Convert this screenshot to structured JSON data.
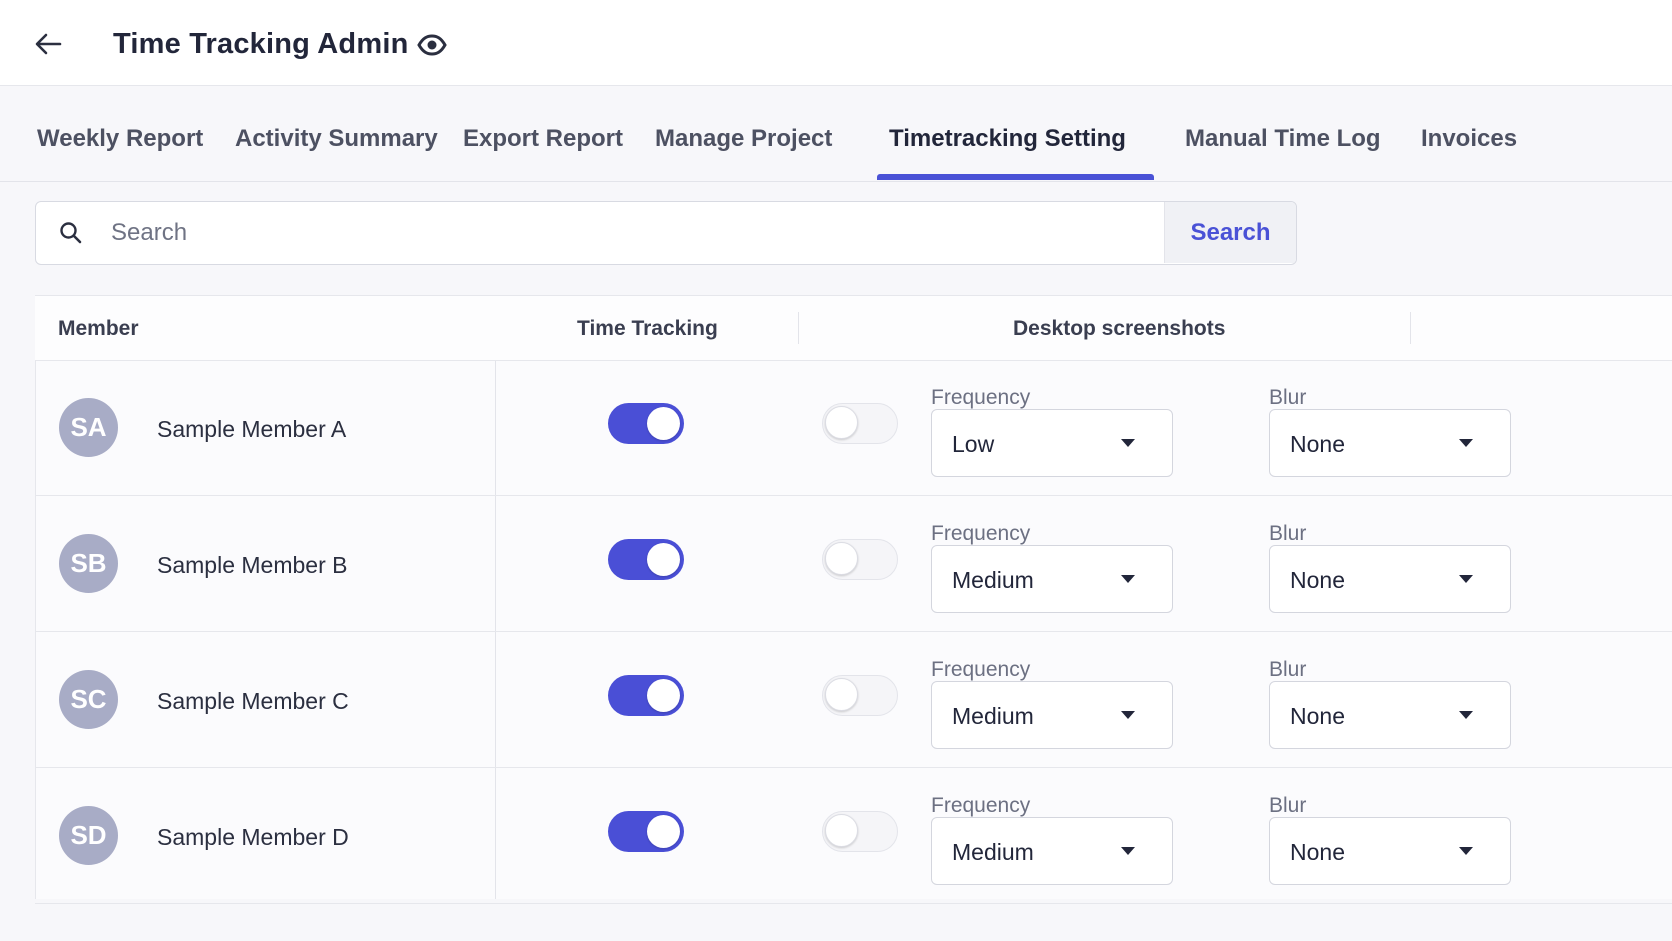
{
  "header": {
    "title": "Time Tracking Admin",
    "back_icon": "arrow-left-icon",
    "view_icon": "eye-icon"
  },
  "tabs": [
    {
      "label": "Weekly Report",
      "active": false
    },
    {
      "label": "Activity Summary",
      "active": false
    },
    {
      "label": "Export Report",
      "active": false
    },
    {
      "label": "Manage Project",
      "active": false
    },
    {
      "label": "Timetracking Setting",
      "active": true
    },
    {
      "label": "Manual Time Log",
      "active": false
    },
    {
      "label": "Invoices",
      "active": false
    }
  ],
  "search": {
    "placeholder": "Search",
    "value": "",
    "button_label": "Search",
    "icon": "search-icon"
  },
  "table": {
    "columns": {
      "member": "Member",
      "time_tracking": "Time Tracking",
      "desktop_screenshots": "Desktop screenshots"
    },
    "frequency_label": "Frequency",
    "blur_label": "Blur",
    "rows": [
      {
        "initials": "SA",
        "name": "Sample Member A",
        "time_tracking": true,
        "screenshots": false,
        "frequency": "Low",
        "blur": "None"
      },
      {
        "initials": "SB",
        "name": "Sample Member B",
        "time_tracking": true,
        "screenshots": false,
        "frequency": "Medium",
        "blur": "None"
      },
      {
        "initials": "SC",
        "name": "Sample Member C",
        "time_tracking": true,
        "screenshots": false,
        "frequency": "Medium",
        "blur": "None"
      },
      {
        "initials": "SD",
        "name": "Sample Member D",
        "time_tracking": true,
        "screenshots": false,
        "frequency": "Medium",
        "blur": "None"
      }
    ]
  },
  "colors": {
    "accent": "#4a52d6",
    "avatar": "#a8acc6",
    "background": "#f7f7fa"
  }
}
